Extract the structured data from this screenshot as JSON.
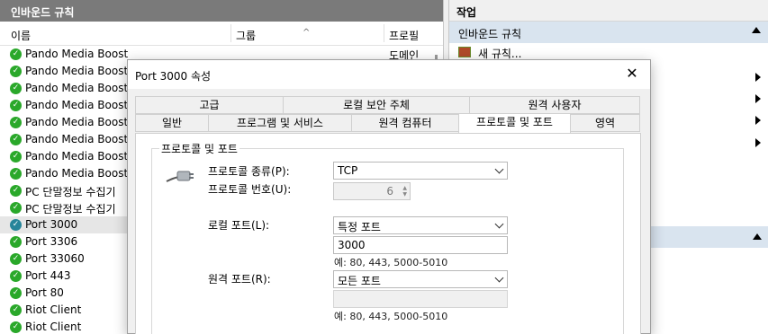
{
  "left_panel": {
    "title": "인바운드 규칙",
    "columns": {
      "name": "이름",
      "group": "그룹",
      "profile": "프로필"
    },
    "rows": [
      {
        "name": "Pando Media Booster",
        "profile": "도메인"
      },
      {
        "name": "Pando Media Booster",
        "profile": ""
      },
      {
        "name": "Pando Media Booster",
        "profile": ""
      },
      {
        "name": "Pando Media Booster",
        "profile": ""
      },
      {
        "name": "Pando Media Booster",
        "profile": ""
      },
      {
        "name": "Pando Media Booster",
        "profile": ""
      },
      {
        "name": "Pando Media Booster",
        "profile": ""
      },
      {
        "name": "Pando Media Booster",
        "profile": ""
      },
      {
        "name": "PC 단말정보 수집기",
        "profile": ""
      },
      {
        "name": "PC 단말정보 수집기",
        "profile": ""
      },
      {
        "name": "Port 3000",
        "profile": "",
        "selected": true
      },
      {
        "name": "Port 3306",
        "profile": ""
      },
      {
        "name": "Port 33060",
        "profile": ""
      },
      {
        "name": "Port 443",
        "profile": ""
      },
      {
        "name": "Port 80",
        "profile": ""
      },
      {
        "name": "Riot Client",
        "profile": ""
      },
      {
        "name": "Riot Client",
        "profile": ""
      }
    ]
  },
  "right_panel": {
    "title": "작업",
    "section": "인바운드 규칙",
    "new_rule": "새 규칙..."
  },
  "dialog": {
    "title": "Port 3000 속성",
    "close": "✕",
    "tabs_row1": [
      "고급",
      "로컬 보안 주체",
      "원격 사용자"
    ],
    "tabs_row2": [
      "일반",
      "프로그램 및 서비스",
      "원격 컴퓨터",
      "프로토콜 및 포트",
      "영역"
    ],
    "group_title": "프로토콜 및 포트",
    "protocol_type_label": "프로토콜 종류(P):",
    "protocol_type_value": "TCP",
    "protocol_number_label": "프로토콜 번호(U):",
    "protocol_number_value": "6",
    "local_port_label": "로컬 포트(L):",
    "local_port_mode": "특정 포트",
    "local_port_value": "3000",
    "local_port_hint": "예: 80, 443, 5000-5010",
    "remote_port_label": "원격 포트(R):",
    "remote_port_mode": "모든 포트",
    "remote_port_value": "",
    "remote_port_hint": "예: 80, 443, 5000-5010"
  },
  "colors": {
    "header_gray": "#7a7a7a",
    "section_blue": "#d9e4ef",
    "status_green": "#2aa82a"
  }
}
